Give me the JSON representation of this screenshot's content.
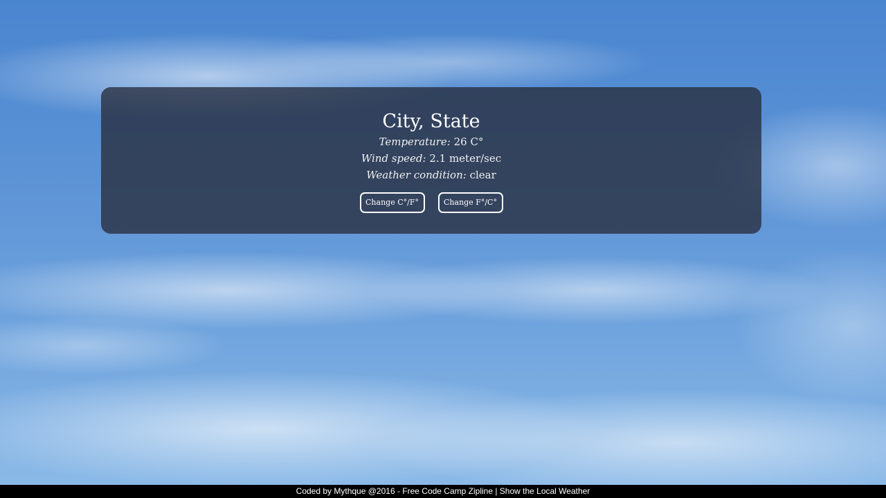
{
  "weather": {
    "location": "City, State",
    "temperature_label": "Temperature:",
    "temperature_value": "26 C°",
    "wind_label": "Wind speed:",
    "wind_value": "2.1 meter/sec",
    "condition_label": "Weather condition:",
    "condition_value": "clear"
  },
  "buttons": {
    "to_fahrenheit": "Change C°/F°",
    "to_celsius": "Change F°/C°"
  },
  "footer": {
    "text": "Coded by Mythque @2016 - Free Code Camp Zipline | Show the Local Weather"
  },
  "colors": {
    "card_background": "#282d3c",
    "text": "#ffffff",
    "footer_background": "#000000",
    "sky": "#5c93d6"
  }
}
